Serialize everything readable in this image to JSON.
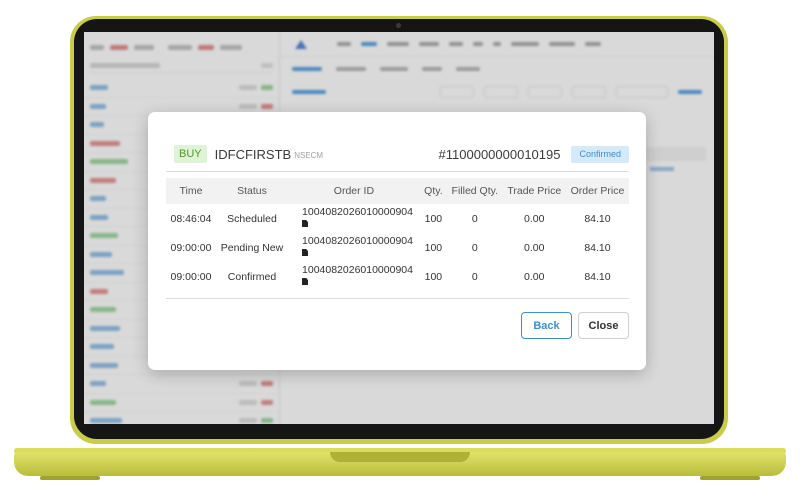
{
  "order_modal": {
    "side_badge": "BUY",
    "symbol": "IDFCFIRSTB",
    "exchange": "NSECM",
    "order_number": "#1100000000010195",
    "status_badge": "Confirmed",
    "columns": [
      "Time",
      "Status",
      "Order ID",
      "Qty.",
      "Filled Qty.",
      "Trade Price",
      "Order Price"
    ],
    "rows": [
      {
        "time": "08:46:04",
        "status": "Scheduled",
        "order_id": "1004082026010000904",
        "qty": "100",
        "filled_qty": "0",
        "trade_price": "0.00",
        "order_price": "84.10"
      },
      {
        "time": "09:00:00",
        "status": "Pending New",
        "order_id": "1004082026010000904",
        "qty": "100",
        "filled_qty": "0",
        "trade_price": "0.00",
        "order_price": "84.10"
      },
      {
        "time": "09:00:00",
        "status": "Confirmed",
        "order_id": "1004082026010000904",
        "qty": "100",
        "filled_qty": "0",
        "trade_price": "0.00",
        "order_price": "84.10"
      }
    ],
    "back_label": "Back",
    "close_label": "Close"
  },
  "colors": {
    "laptop_body": "#c8cc4a",
    "buy_green": "#4c9a2a",
    "confirmed_blue": "#3d8fcb",
    "link_blue": "#3b8fd9"
  },
  "icons": {
    "copy": "document-copy-icon",
    "logo": "triangle-logo-icon"
  }
}
